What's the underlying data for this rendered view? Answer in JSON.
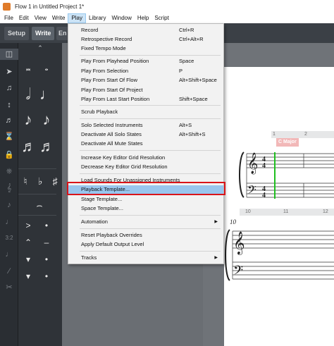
{
  "window": {
    "title": "Flow 1 in Untitled Project 1*"
  },
  "menubar": [
    "File",
    "Edit",
    "View",
    "Write",
    "Play",
    "Library",
    "Window",
    "Help",
    "Script"
  ],
  "modes": {
    "setup": "Setup",
    "write": "Write",
    "engrave": "En"
  },
  "play_menu": {
    "record": {
      "label": "Record",
      "shortcut": "Ctrl+R"
    },
    "retro_record": {
      "label": "Retrospective Record",
      "shortcut": "Ctrl+Alt+R"
    },
    "fixed_tempo": {
      "label": "Fixed Tempo Mode"
    },
    "play_from_playhead": {
      "label": "Play From Playhead Position",
      "shortcut": "Space"
    },
    "play_from_selection": {
      "label": "Play From Selection",
      "shortcut": "P"
    },
    "play_from_start_flow": {
      "label": "Play From Start Of Flow",
      "shortcut": "Alt+Shift+Space"
    },
    "play_from_start_project": {
      "label": "Play From Start Of Project"
    },
    "play_from_last_start": {
      "label": "Play From Last Start Position",
      "shortcut": "Shift+Space"
    },
    "scrub": {
      "label": "Scrub Playback"
    },
    "solo_selected": {
      "label": "Solo Selected Instruments",
      "shortcut": "Alt+S"
    },
    "deactivate_solo": {
      "label": "Deactivate All Solo States",
      "shortcut": "Alt+Shift+S"
    },
    "deactivate_mute": {
      "label": "Deactivate All Mute States"
    },
    "increase_grid": {
      "label": "Increase Key Editor Grid Resolution"
    },
    "decrease_grid": {
      "label": "Decrease Key Editor Grid Resolution"
    },
    "load_sounds": {
      "label": "Load Sounds For Unassigned Instruments"
    },
    "playback_template": {
      "label": "Playback Template..."
    },
    "stage_template": {
      "label": "Stage Template..."
    },
    "space_template": {
      "label": "Space Template..."
    },
    "automation": {
      "label": "Automation"
    },
    "reset_overrides": {
      "label": "Reset Playback Overrides"
    },
    "apply_output": {
      "label": "Apply Default Output Level"
    },
    "tracks": {
      "label": "Tracks"
    }
  },
  "score": {
    "bar1": "1",
    "bar2": "2",
    "key": "C Major",
    "bar10": "10",
    "bar10_italic": "10"
  }
}
